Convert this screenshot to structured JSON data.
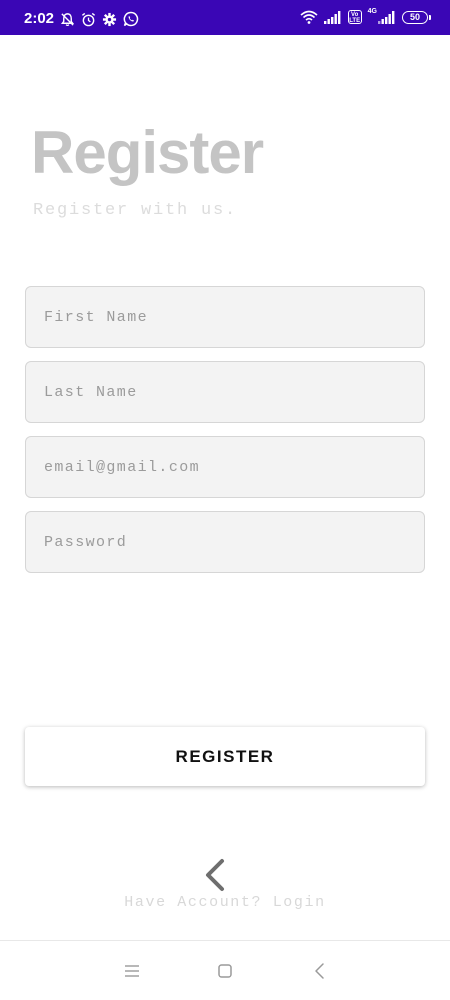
{
  "status_bar": {
    "time": "2:02",
    "network_type": "4G",
    "volte": "Vo LTE",
    "battery": "50",
    "background_color": "#3a06b5",
    "left_icons": [
      "muted-bell-icon",
      "alarm-icon",
      "gear-icon",
      "whatsapp-icon"
    ],
    "right_icons": [
      "wifi-icon",
      "signal-icon",
      "volte-icon",
      "signal-icon",
      "battery-icon"
    ]
  },
  "header": {
    "title": "Register",
    "subtitle": "Register with us."
  },
  "form": {
    "first_name_placeholder": "First Name",
    "last_name_placeholder": "Last Name",
    "email_placeholder": "email@gmail.com",
    "password_placeholder": "Password",
    "register_label": "REGISTER"
  },
  "footer": {
    "back_icon": "chevron-left-icon",
    "login_text": "Have Account? Login"
  },
  "nav_bar": {
    "icons": [
      "menu-icon",
      "home-icon",
      "back-icon"
    ]
  }
}
